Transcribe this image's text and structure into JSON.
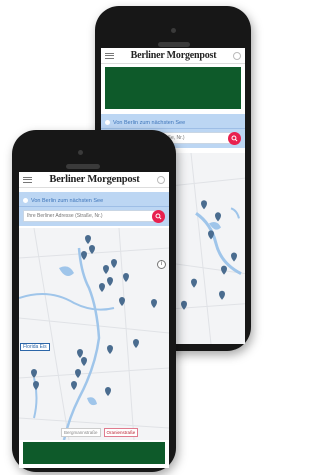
{
  "app": {
    "brand": "Berliner Morgenpost",
    "panel_title": "Von Berlin zum nächsten See",
    "address_placeholder": "Ihre Berliner Adresse (Straße, Nr.)"
  },
  "map": {
    "place_label": "Florida Eis",
    "info_icon_symbol": "i"
  },
  "chips": [
    "Bergmannstraße",
    "Oranienstraße"
  ],
  "colors": {
    "ad_banner": "#0e5a2a",
    "panel_bg": "#bcd6f3",
    "search_button": "#e8204e",
    "marker": "#4a6c8f",
    "water": "#9fc5ea"
  }
}
